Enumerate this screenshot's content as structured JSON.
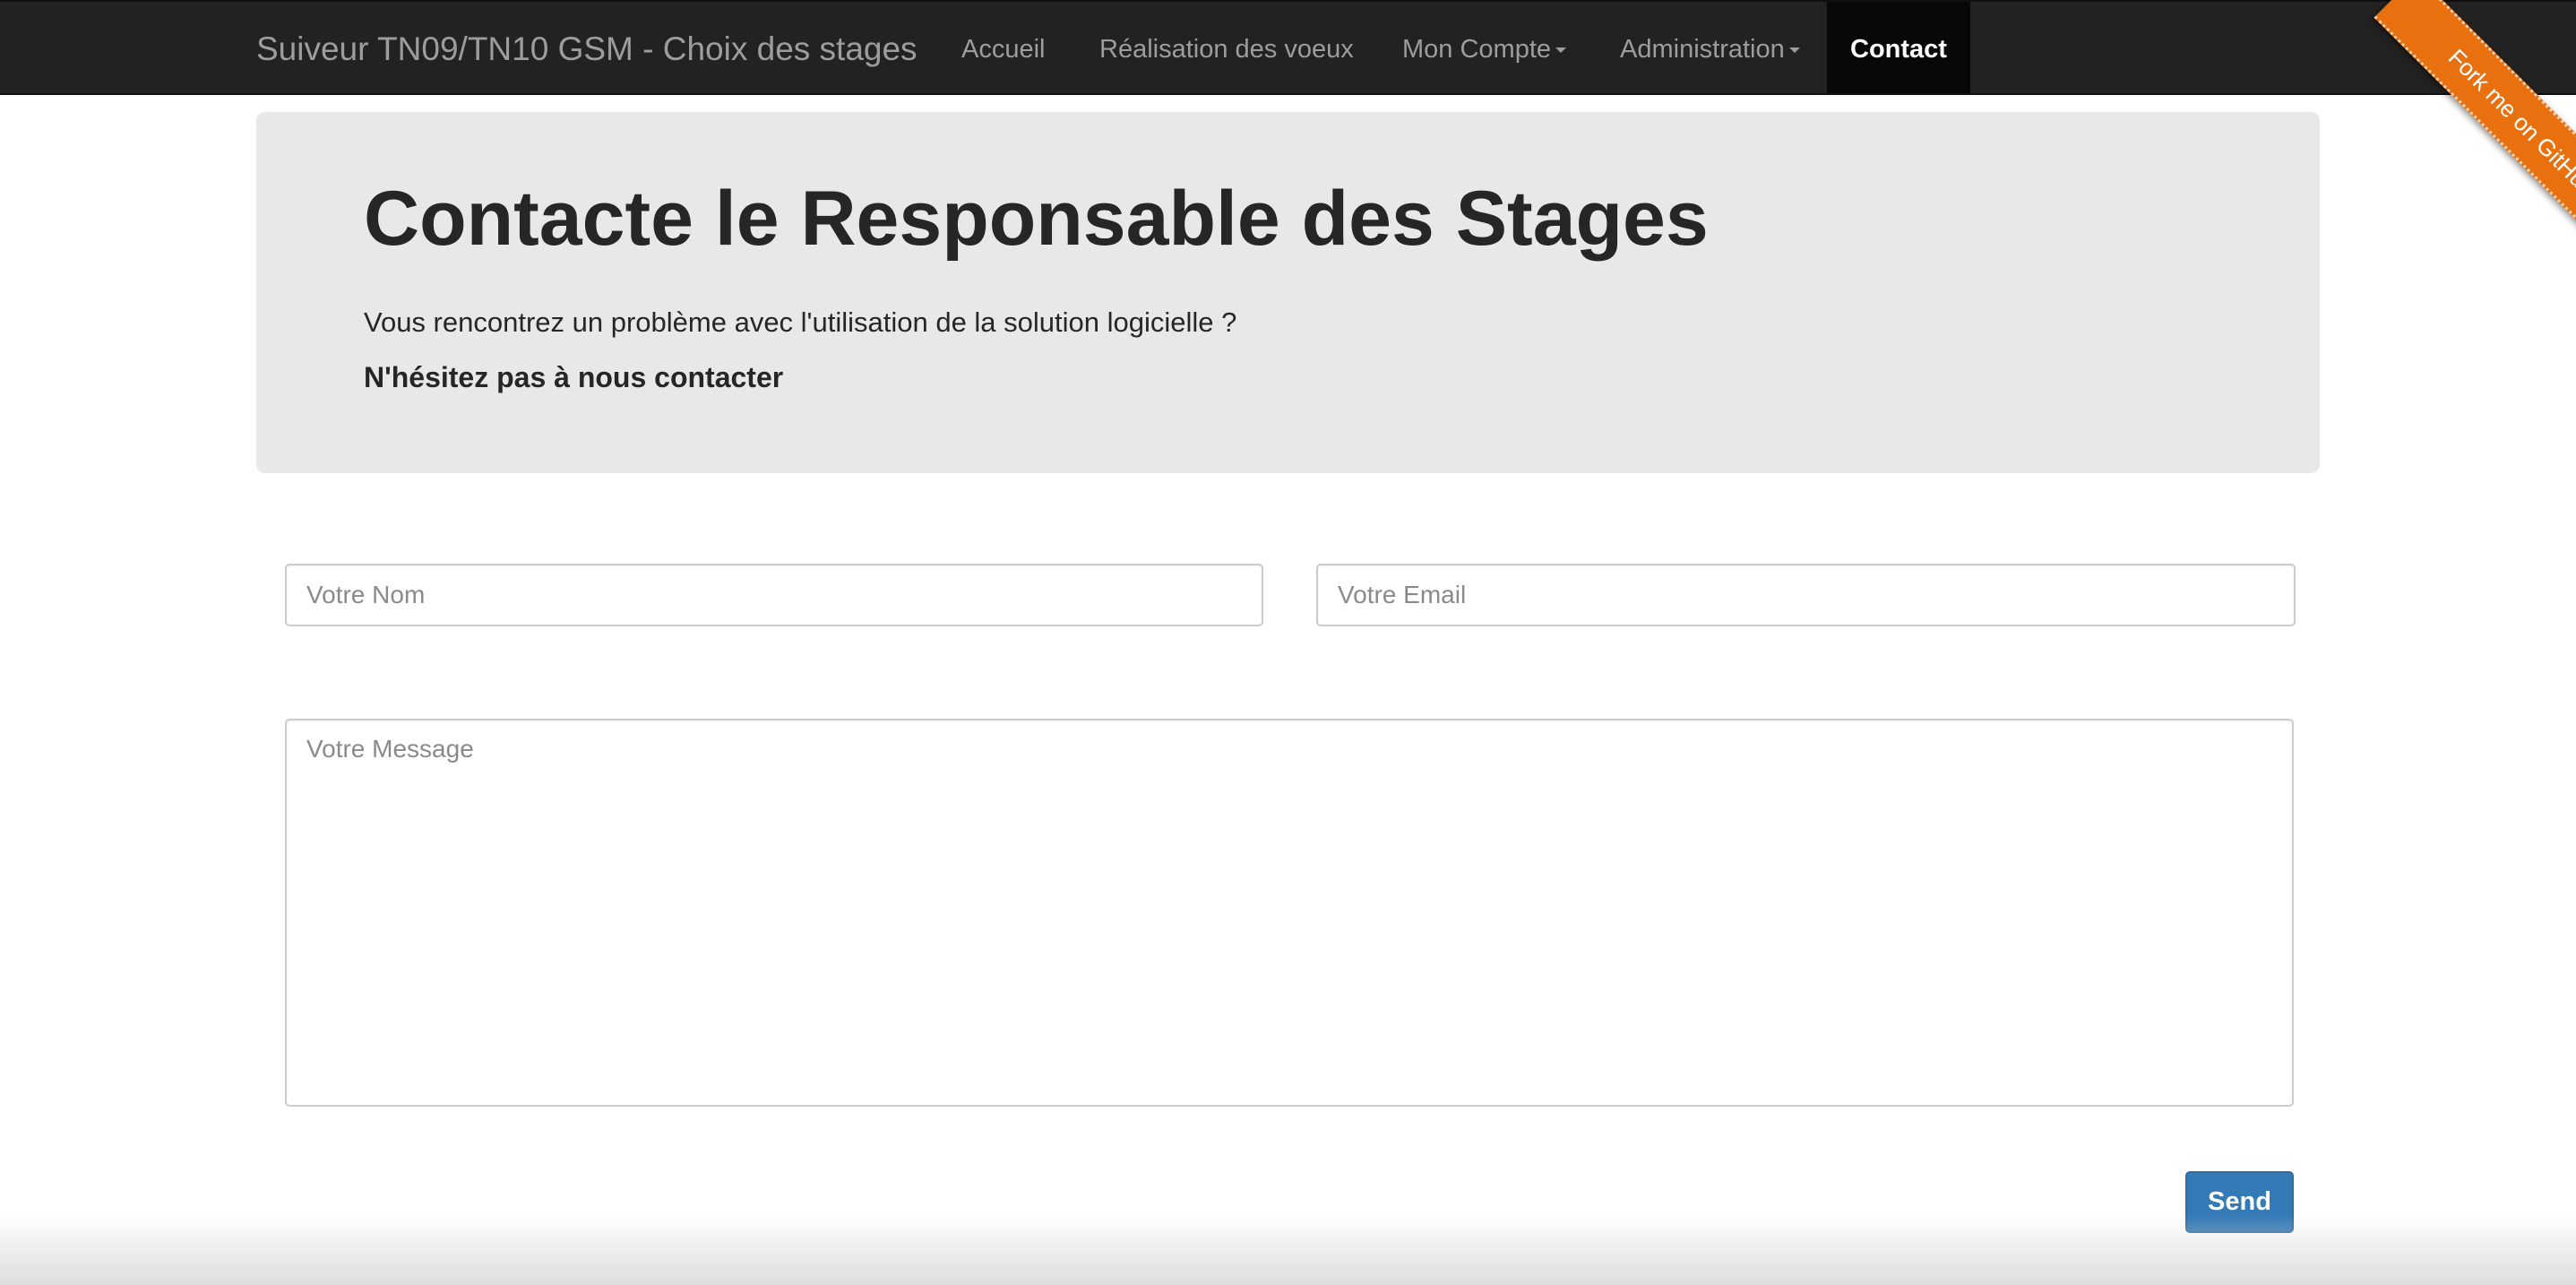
{
  "navbar": {
    "brand": "Suiveur TN09/TN10 GSM - Choix des stages",
    "items": [
      {
        "label": "Accueil"
      },
      {
        "label": "Réalisation des voeux"
      },
      {
        "label": "Mon Compte"
      },
      {
        "label": "Administration"
      },
      {
        "label": "Contact"
      }
    ]
  },
  "ribbon": {
    "label": "Fork me on GitHub"
  },
  "jumbotron": {
    "title": "Contacte le Responsable des Stages",
    "text": "Vous rencontrez un problème avec l'utilisation de la solution logicielle ?",
    "strong": "N'hésitez pas à nous contacter"
  },
  "form": {
    "name_placeholder": "Votre Nom",
    "email_placeholder": "Votre Email",
    "message_placeholder": "Votre Message",
    "send_label": "Send"
  },
  "colors": {
    "navbar_bg": "#222222",
    "ribbon": "#e8700f",
    "jumbotron_bg": "#e8e8e8",
    "primary_button": "#337ab7"
  }
}
